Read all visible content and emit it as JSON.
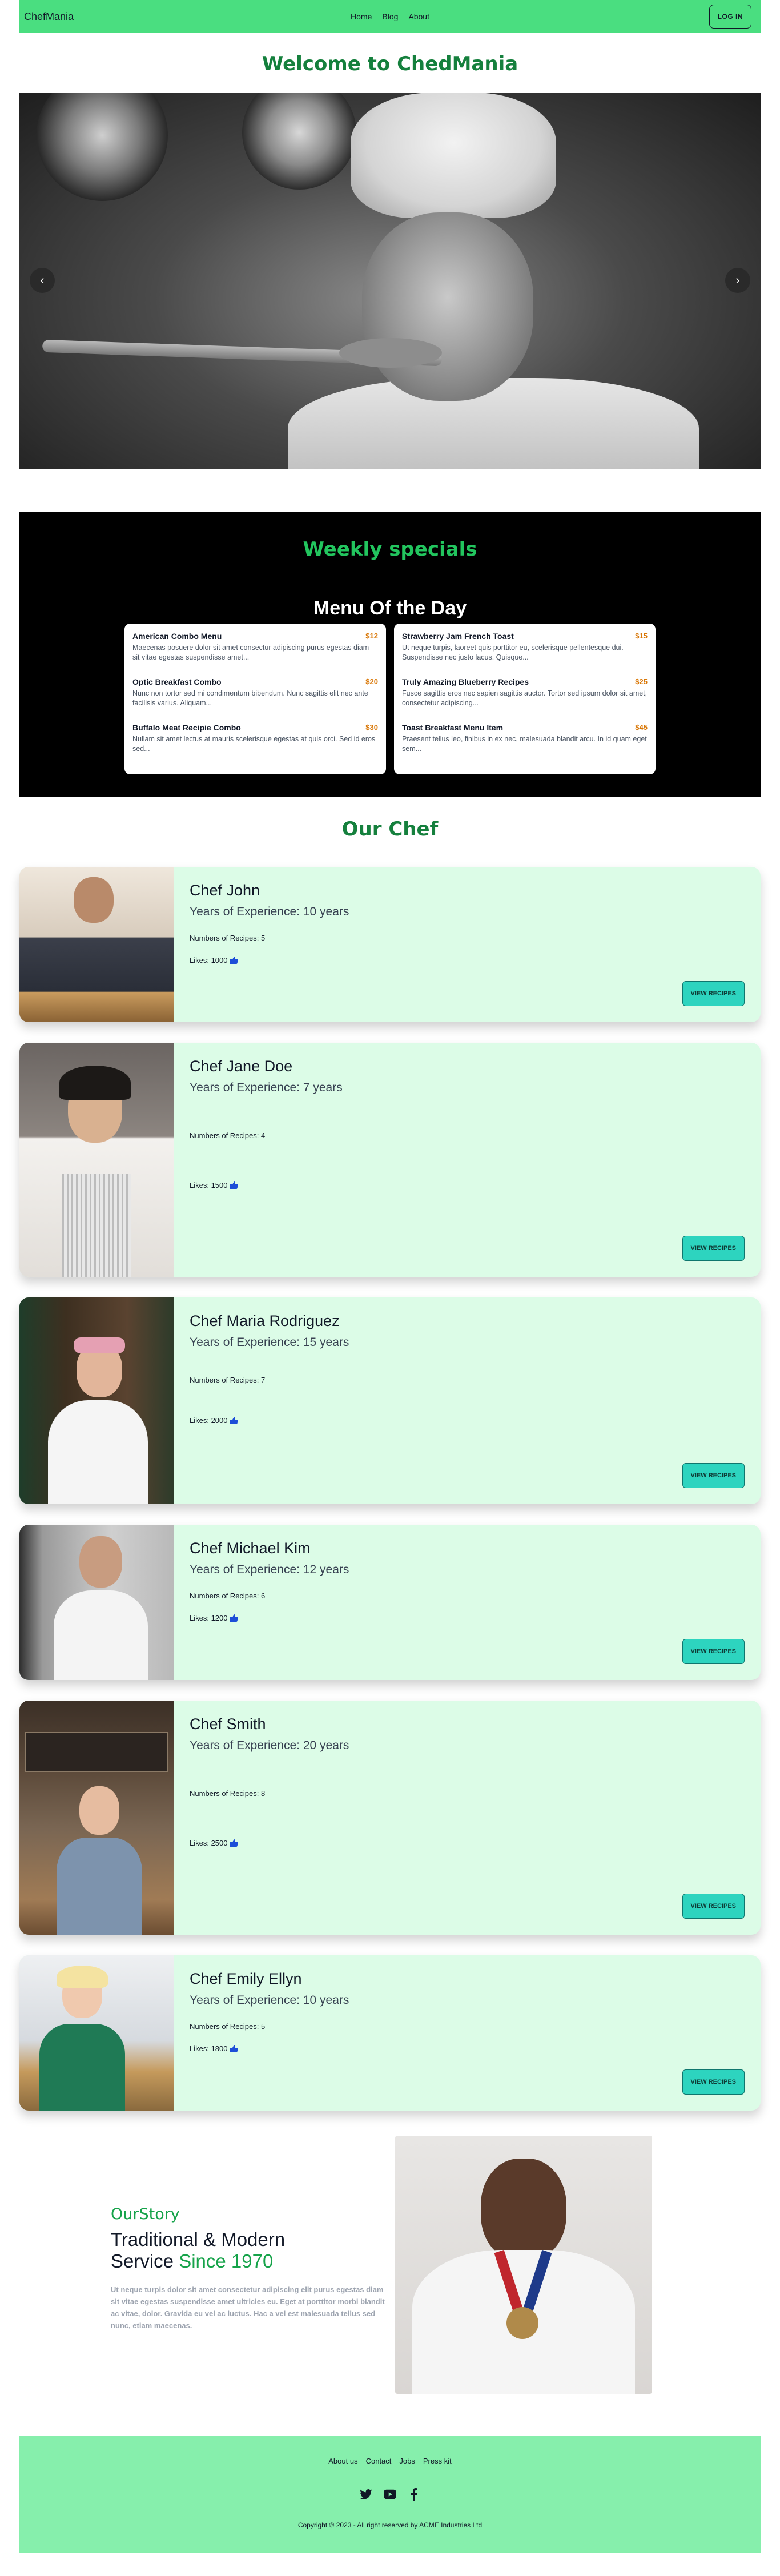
{
  "navbar": {
    "brand": "ChefMania",
    "links": [
      "Home",
      "Blog",
      "About"
    ],
    "login_label": "LOG IN"
  },
  "hero": {
    "title": "Welcome to ChedMania",
    "prev_icon": "chevron-left-icon",
    "next_icon": "chevron-right-icon"
  },
  "specials": {
    "title": "Weekly specials",
    "subtitle": "Menu Of the Day",
    "columns": [
      [
        {
          "name": "American Combo Menu",
          "price": "$12",
          "desc": "Maecenas posuere dolor sit amet consectur adipiscing purus egestas diam sit vitae egestas suspendisse amet..."
        },
        {
          "name": "Optic Breakfast Combo",
          "price": "$20",
          "desc": "Nunc non tortor sed mi condimentum bibendum. Nunc sagittis elit nec ante facilisis varius. Aliquam..."
        },
        {
          "name": "Buffalo Meat Recipie Combo",
          "price": "$30",
          "desc": "Nullam sit amet lectus at mauris scelerisque egestas at quis orci. Sed id eros sed..."
        }
      ],
      [
        {
          "name": "Strawberry Jam French Toast",
          "price": "$15",
          "desc": "Ut neque turpis, laoreet quis porttitor eu, scelerisque pellentesque dui. Suspendisse nec justo lacus. Quisque..."
        },
        {
          "name": "Truly Amazing Blueberry Recipes",
          "price": "$25",
          "desc": "Fusce sagittis eros nec sapien sagittis auctor. Tortor sed ipsum dolor sit amet, consectetur adipiscing..."
        },
        {
          "name": "Toast Breakfast Menu Item",
          "price": "$45",
          "desc": "Praesent tellus leo, finibus in ex nec, malesuada blandit arcu. In id quam eget sem..."
        }
      ]
    ]
  },
  "chefs_section": {
    "title": "Our Chef",
    "button_label": "VIEW RECIPES",
    "chefs": [
      {
        "name": "Chef John",
        "experience": "Years of Experience: 10 years",
        "recipes": "Numbers of Recipes: 5",
        "likes": "Likes: 1000"
      },
      {
        "name": "Chef Jane Doe",
        "experience": "Years of Experience: 7 years",
        "recipes": "Numbers of Recipes: 4",
        "likes": "Likes: 1500"
      },
      {
        "name": "Chef Maria Rodriguez",
        "experience": "Years of Experience: 15 years",
        "recipes": "Numbers of Recipes: 7",
        "likes": "Likes: 2000"
      },
      {
        "name": "Chef Michael Kim",
        "experience": "Years of Experience: 12 years",
        "recipes": "Numbers of Recipes: 6",
        "likes": "Likes: 1200"
      },
      {
        "name": "Chef Smith",
        "experience": "Years of Experience: 20 years",
        "recipes": "Numbers of Recipes: 8",
        "likes": "Likes: 2500"
      },
      {
        "name": "Chef Emily Ellyn",
        "experience": "Years of Experience: 10 years",
        "recipes": "Numbers of Recipes: 5",
        "likes": "Likes: 1800"
      }
    ]
  },
  "story": {
    "label": "OurStory",
    "title_line1": "Traditional & Modern",
    "title_line2": "Service ",
    "title_accent": "Since 1970",
    "body": "Ut neque turpis dolor sit amet consectetur adipiscing elit purus egestas diam sit vitae egestas suspendisse amet ultricies eu. Eget at porttitor morbi blandit ac vitae, dolor. Gravida eu vel ac luctus. Hac a vel est malesuada tellus sed nunc, etiam maecenas."
  },
  "footer": {
    "links": [
      "About us",
      "Contact",
      "Jobs",
      "Press kit"
    ],
    "social_icons": [
      "twitter-icon",
      "youtube-icon",
      "facebook-icon"
    ],
    "copyright": "Copyright © 2023 - All right reserved by ACME Industries Ltd"
  },
  "colors": {
    "nav_bg": "#4ade80",
    "heading_green": "#15803d",
    "card_bg": "#dcfce7",
    "button_teal": "#2dd4bf",
    "price": "#d97706",
    "footer_bg": "#86efac"
  }
}
